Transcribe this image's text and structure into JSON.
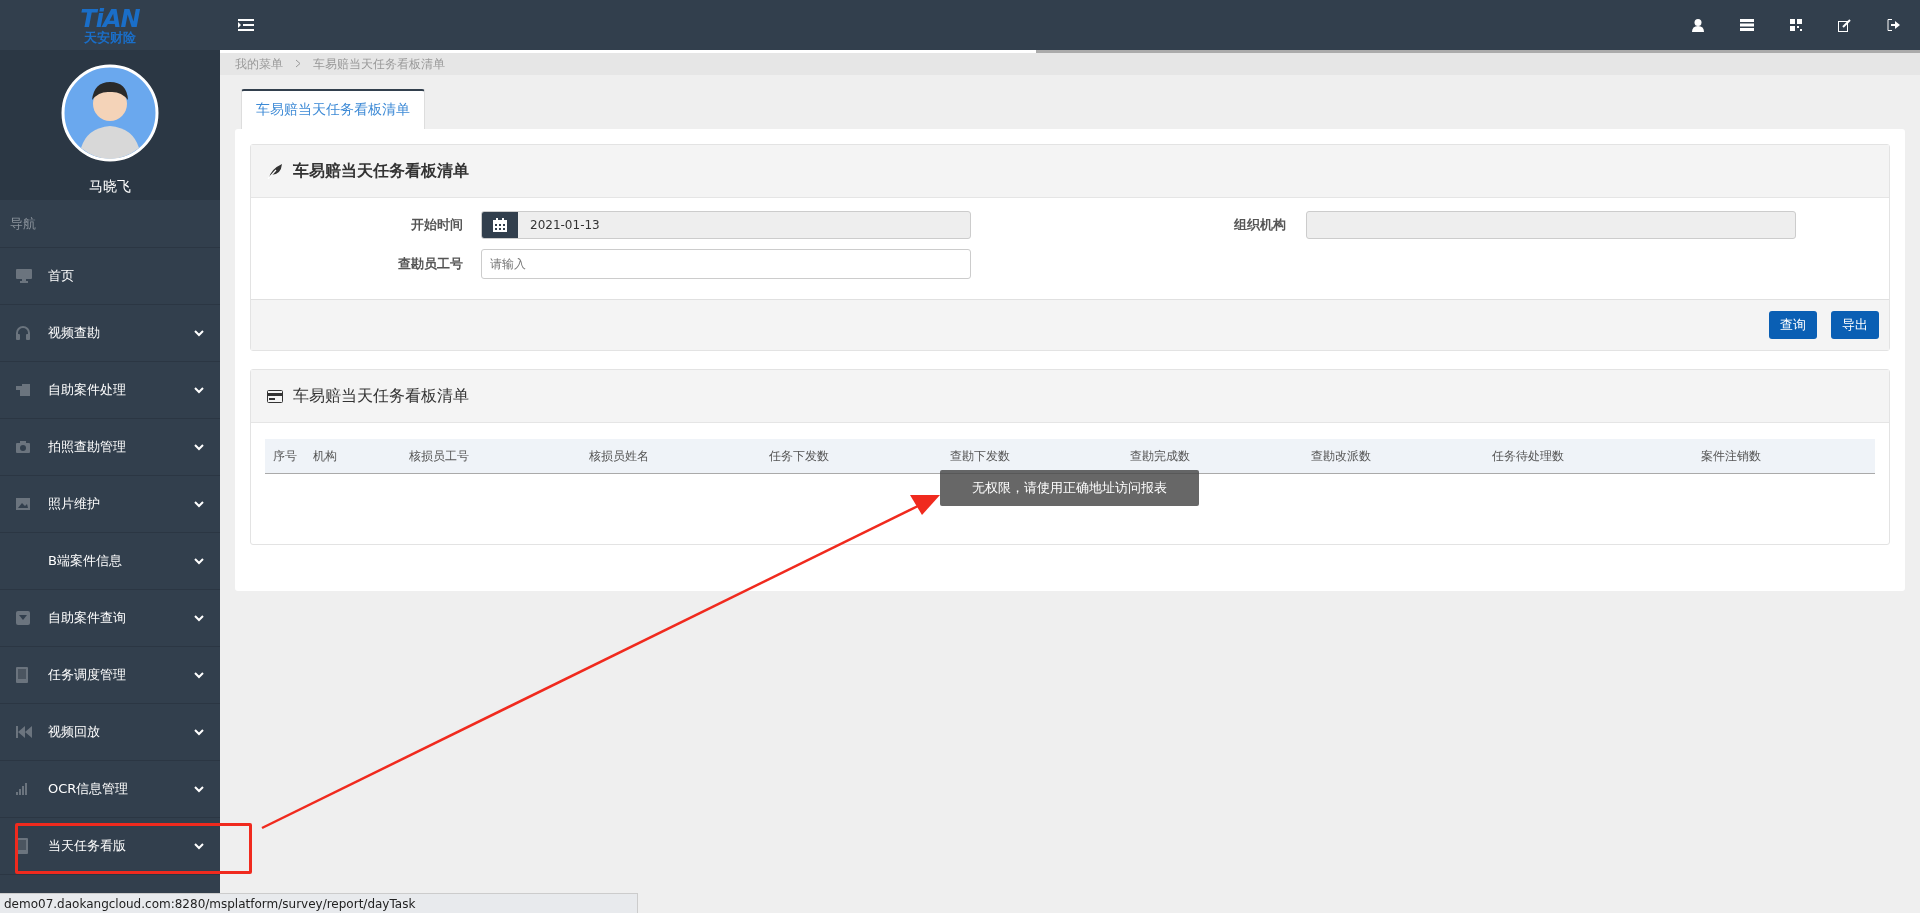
{
  "logo": {
    "brand": "TiAN",
    "name": "天安财险"
  },
  "user": {
    "name": "马晓飞"
  },
  "sidebar": {
    "heading": "导航",
    "items": [
      {
        "label": "首页",
        "expandable": false
      },
      {
        "label": "视频查勘",
        "expandable": true
      },
      {
        "label": "自助案件处理",
        "expandable": true
      },
      {
        "label": "拍照查勘管理",
        "expandable": true
      },
      {
        "label": "照片维护",
        "expandable": true
      },
      {
        "label": "B端案件信息",
        "expandable": true
      },
      {
        "label": "自助案件查询",
        "expandable": true
      },
      {
        "label": "任务调度管理",
        "expandable": true
      },
      {
        "label": "视频回放",
        "expandable": true
      },
      {
        "label": "OCR信息管理",
        "expandable": true
      },
      {
        "label": "当天任务看版",
        "expandable": true
      }
    ]
  },
  "loading_bar": {
    "level": 0.48
  },
  "breadcrumb": [
    "我的菜单",
    "车易赔当天任务看板清单"
  ],
  "tabs": [
    {
      "label": "车易赔当天任务看板清单",
      "selected": true
    }
  ],
  "search_panel": {
    "title": "车易赔当天任务看板清单",
    "fields": [
      {
        "label": "开始时间",
        "value": "2021-01-13",
        "kind": "date"
      },
      {
        "label": "组织机构",
        "kind": "readonly"
      },
      {
        "label": "查勘员工号",
        "placeholder": "请输入",
        "kind": "text"
      }
    ],
    "buttons": [
      "查询",
      "导出"
    ]
  },
  "table_panel": {
    "title": "车易赔当天任务看板清单",
    "columns": [
      "序号",
      "机构",
      "核损员工号",
      "核损员姓名",
      "任务下发数",
      "查勘下发数",
      "查勘完成数",
      "查勘改派数",
      "任务待处理数",
      "案件注销数"
    ]
  },
  "toast": "无权限，请使用正确地址访问报表",
  "status_bar": "demo07.daokangcloud.com:8280/msplatform/survey/report/dayTask"
}
